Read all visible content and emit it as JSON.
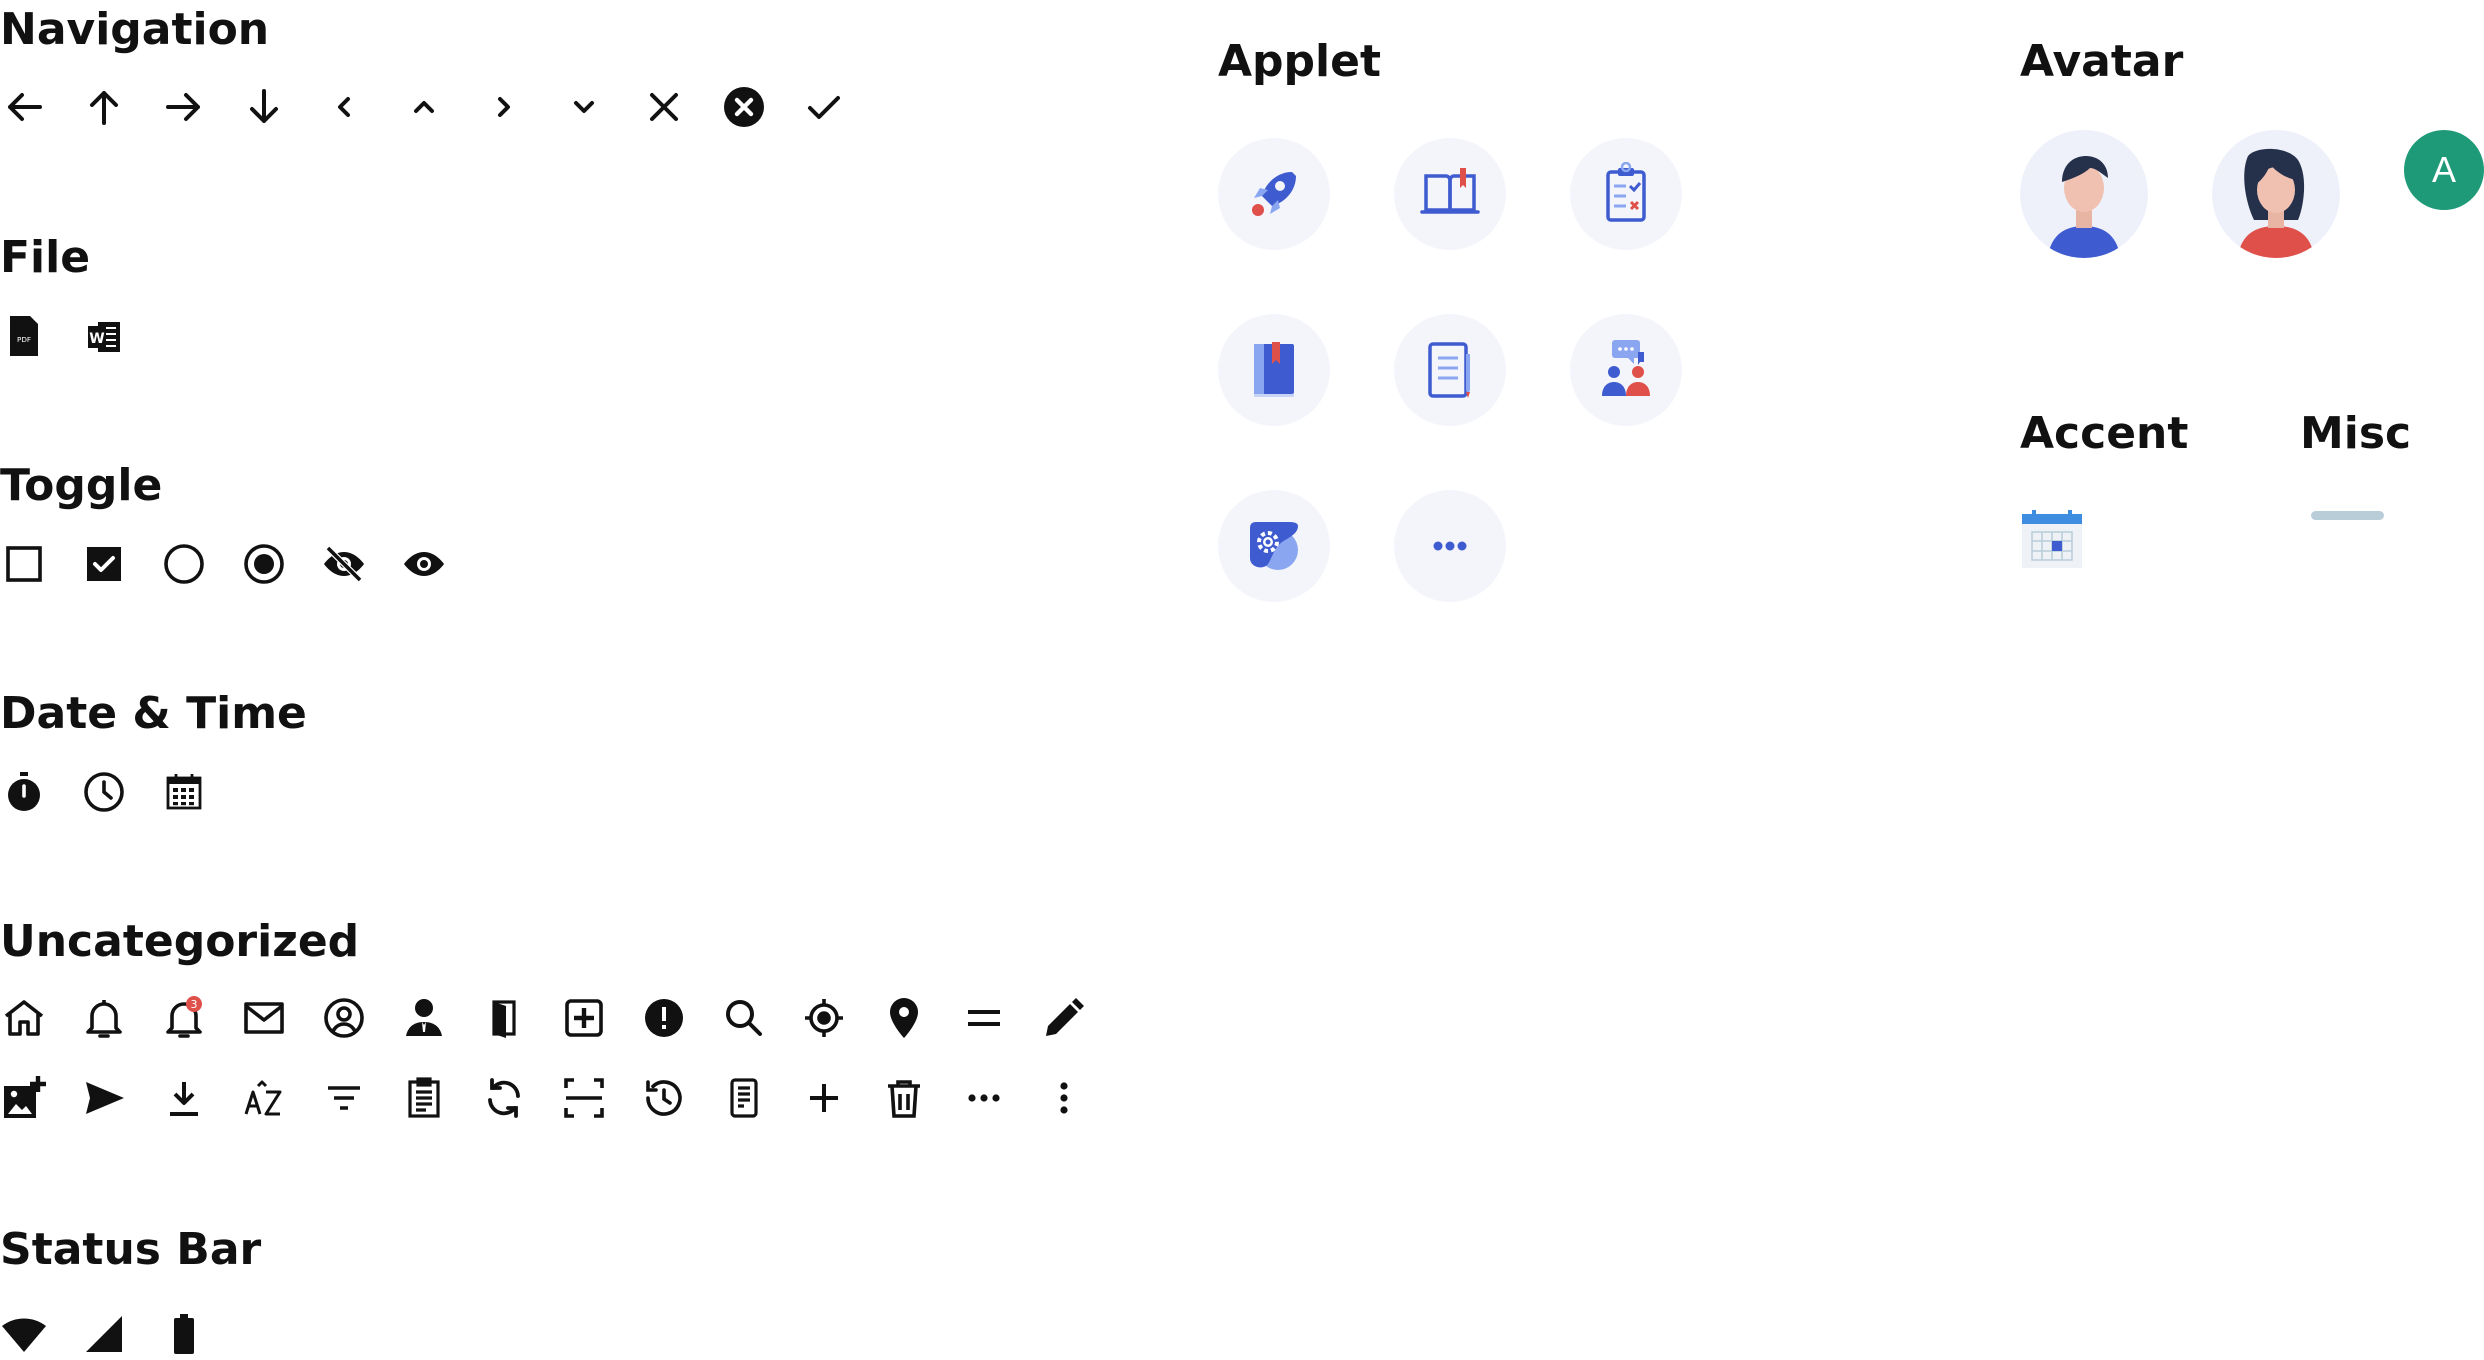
{
  "sections": {
    "navigation": "Navigation",
    "file": "File",
    "toggle": "Toggle",
    "datetime": "Date & Time",
    "uncategorized": "Uncategorized",
    "statusbar": "Status Bar",
    "applet": "Applet",
    "avatar": "Avatar",
    "accent": "Accent",
    "misc": "Misc"
  },
  "file_icons": {
    "pdf_text": "PDF",
    "word_text": "W"
  },
  "notification_badge": "3",
  "avatar_letter": "A",
  "icons": {
    "navigation": [
      "arrow-left-icon",
      "arrow-up-icon",
      "arrow-right-icon",
      "arrow-down-icon",
      "chevron-left-icon",
      "chevron-up-icon",
      "chevron-right-icon",
      "chevron-down-icon",
      "close-icon",
      "close-circle-icon",
      "check-icon"
    ],
    "file": [
      "pdf-file-icon",
      "word-file-icon"
    ],
    "toggle": [
      "checkbox-unchecked-icon",
      "checkbox-checked-icon",
      "radio-unchecked-icon",
      "radio-checked-icon",
      "eye-off-icon",
      "eye-icon"
    ],
    "datetime": [
      "stopwatch-icon",
      "clock-icon",
      "calendar-icon"
    ],
    "uncategorized_row1": [
      "home-icon",
      "bell-icon",
      "bell-badge-icon",
      "mail-icon",
      "account-circle-icon",
      "account-tie-icon",
      "door-icon",
      "plus-box-icon",
      "alert-circle-icon",
      "search-icon",
      "crosshairs-gps-icon",
      "map-marker-icon",
      "equal-icon",
      "pencil-icon"
    ],
    "uncategorized_row2": [
      "image-plus-icon",
      "send-icon",
      "download-icon",
      "sort-alphabetical-icon",
      "filter-icon",
      "clipboard-list-icon",
      "refresh-icon",
      "scan-icon",
      "history-icon",
      "receipt-icon",
      "plus-icon",
      "trash-icon",
      "more-horizontal-icon",
      "more-vertical-icon"
    ],
    "statusbar": [
      "wifi-icon",
      "signal-icon",
      "battery-icon"
    ],
    "applet": [
      "rocket-icon",
      "open-book-icon",
      "clipboard-check-icon",
      "notebook-icon",
      "document-icon",
      "chat-people-icon",
      "settings-icon",
      "more-icon"
    ],
    "avatar": [
      "male-avatar-icon",
      "female-avatar-icon"
    ],
    "accent": [
      "calendar-accent-icon"
    ],
    "misc": [
      "handle-bar-icon"
    ]
  },
  "colors": {
    "applet_blue": "#3f5bd0",
    "applet_light": "#8aa6f0",
    "applet_red": "#e0504a",
    "applet_bg": "#f3f5fb",
    "avatar_green": "#1f9a78",
    "misc_bar": "#b9cdd8"
  }
}
